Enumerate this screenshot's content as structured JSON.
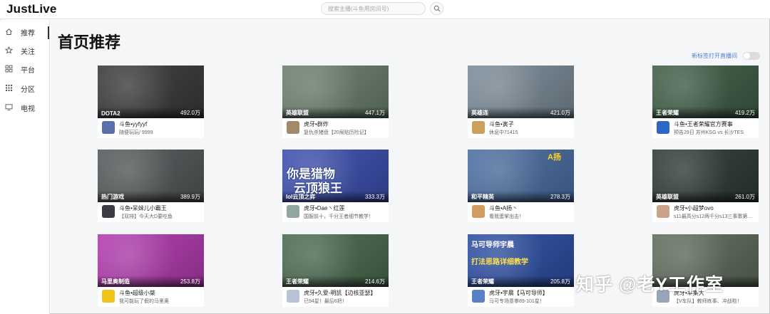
{
  "app": {
    "title": "JustLive"
  },
  "search": {
    "placeholder": "搜索主播(斗鱼用房间号)"
  },
  "sidebar": {
    "items": [
      {
        "label": "推荐",
        "icon": "home-icon",
        "active": true
      },
      {
        "label": "关注",
        "icon": "star-icon",
        "active": false
      },
      {
        "label": "平台",
        "icon": "platform-grid-icon",
        "active": false
      },
      {
        "label": "分区",
        "icon": "category-dots-icon",
        "active": false
      },
      {
        "label": "电视",
        "icon": "tv-icon",
        "active": false
      }
    ]
  },
  "page": {
    "title": "首页推荐",
    "new_tab_label": "新标签打开直播间",
    "new_tab_enabled": false
  },
  "cards": [
    {
      "category": "DOTA2",
      "views": "492.0万",
      "name": "斗鱼•yyfyyf",
      "room": "随便玩玩/ 9999",
      "thumb_color": "#3a3a3a",
      "avatar_color": "#5b6fa8"
    },
    {
      "category": "英雄联盟",
      "views": "447.1万",
      "name": "虎牙•群炸",
      "room": "复仇杀猪盘【20局贴历险记】",
      "thumb_color": "#6b7f6e",
      "avatar_color": "#a08a6a"
    },
    {
      "category": "英雄连",
      "views": "421.0万",
      "name": "斗鱼•寅子",
      "room": "休息中71415",
      "thumb_color": "#7b8c99",
      "avatar_color": "#c9a15a"
    },
    {
      "category": "王者荣耀",
      "views": "419.2万",
      "name": "斗鱼•王者荣耀官方赛事",
      "room": "预告29日 苏州KSG vs 长沙TES",
      "thumb_color": "#3f5e46",
      "avatar_color": "#2d66c4"
    },
    {
      "category": "热门游戏",
      "views": "389.9万",
      "name": "斗鱼•呆妹儿小霸王",
      "room": "【双排】今天大D要吃鱼",
      "thumb_color": "#55585a",
      "avatar_color": "#3b3b45"
    },
    {
      "category": "lol云顶之弈",
      "views": "333.3万",
      "name": "虎牙•Dae丶红莲",
      "room": "国服前十，千分王者细节教学！",
      "thumb_color": "#3b4fb0",
      "avatar_color": "#8fa7a0"
    },
    {
      "category": "和平精英",
      "views": "278.3万",
      "name": "斗鱼•A扬丶",
      "room": "看我蛋掌出击！",
      "thumb_color": "#4b6fa3",
      "avatar_color": "#d09c62"
    },
    {
      "category": "英雄联盟",
      "views": "261.0万",
      "name": "虎牙•小超梦ovo",
      "room": "s11最高分s12两千分s13三事寨第…",
      "thumb_color": "#2f3a36",
      "avatar_color": "#caa48a"
    },
    {
      "category": "马里奥制造",
      "views": "253.8万",
      "name": "斗鱼•超级小桀",
      "room": "我可能玩了假的马里奥",
      "thumb_color": "#b43ab0",
      "avatar_color": "#f0c419"
    },
    {
      "category": "王者荣耀",
      "views": "214.6万",
      "name": "虎牙•久爱-明凯【边核亚瑟】",
      "room": "已94星！最后6把！",
      "thumb_color": "#4b6b4f",
      "avatar_color": "#b8c2d6"
    },
    {
      "category": "王者荣耀",
      "views": "205.8万",
      "name": "虎牙•宇晨【马可导师】",
      "room": "马可专场意拳89-101星！",
      "thumb_color": "#2c4fa5",
      "avatar_color": "#5a7fc4"
    },
    {
      "category": "",
      "views": "",
      "name": "虎牙•本案大",
      "room": "【V车队】教师练事、冲战啦！",
      "thumb_color": "#5f6d5d",
      "avatar_color": "#9aa4b8"
    }
  ],
  "thumb_overlays": {
    "card5_line1": "你是猎物",
    "card5_line2": "云顶狼王",
    "card6_tag": "A扬",
    "card10_line1": "马可导师宇晨",
    "card10_line2": "打法思路详细教学"
  },
  "watermark": {
    "text": "知乎 @老Y工作室"
  }
}
